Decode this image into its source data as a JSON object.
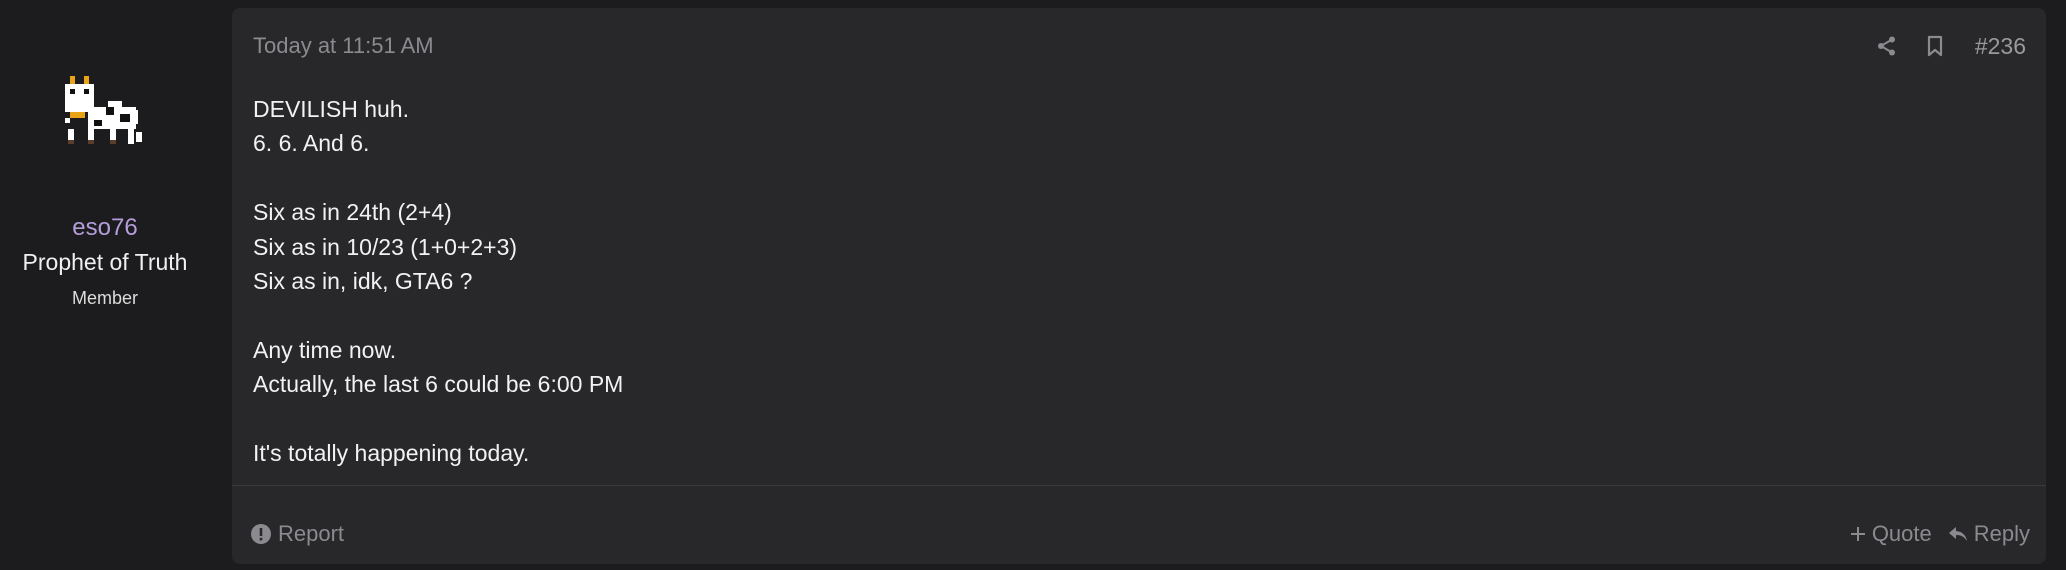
{
  "user": {
    "name": "eso76",
    "title": "Prophet of Truth",
    "banner": "Member",
    "avatar_icon": "pixel-cow-avatar",
    "name_color": "#b39ddb"
  },
  "post": {
    "date": "Today at 11:51 AM",
    "number": "#236",
    "share_icon": "share-icon",
    "bookmark_icon": "bookmark-icon",
    "lines": [
      "DEVILISH huh.",
      "6. 6. And 6.",
      "",
      "Six as in 24th (2+4)",
      "Six as in 10/23 (1+0+2+3)",
      "Six as in, idk, GTA6 ?",
      "",
      "Any time now.",
      "Actually, the last 6 could be 6:00 PM",
      "",
      "It's totally happening today."
    ]
  },
  "footer": {
    "report_label": "Report",
    "quote_label": "Quote",
    "reply_label": "Reply"
  }
}
